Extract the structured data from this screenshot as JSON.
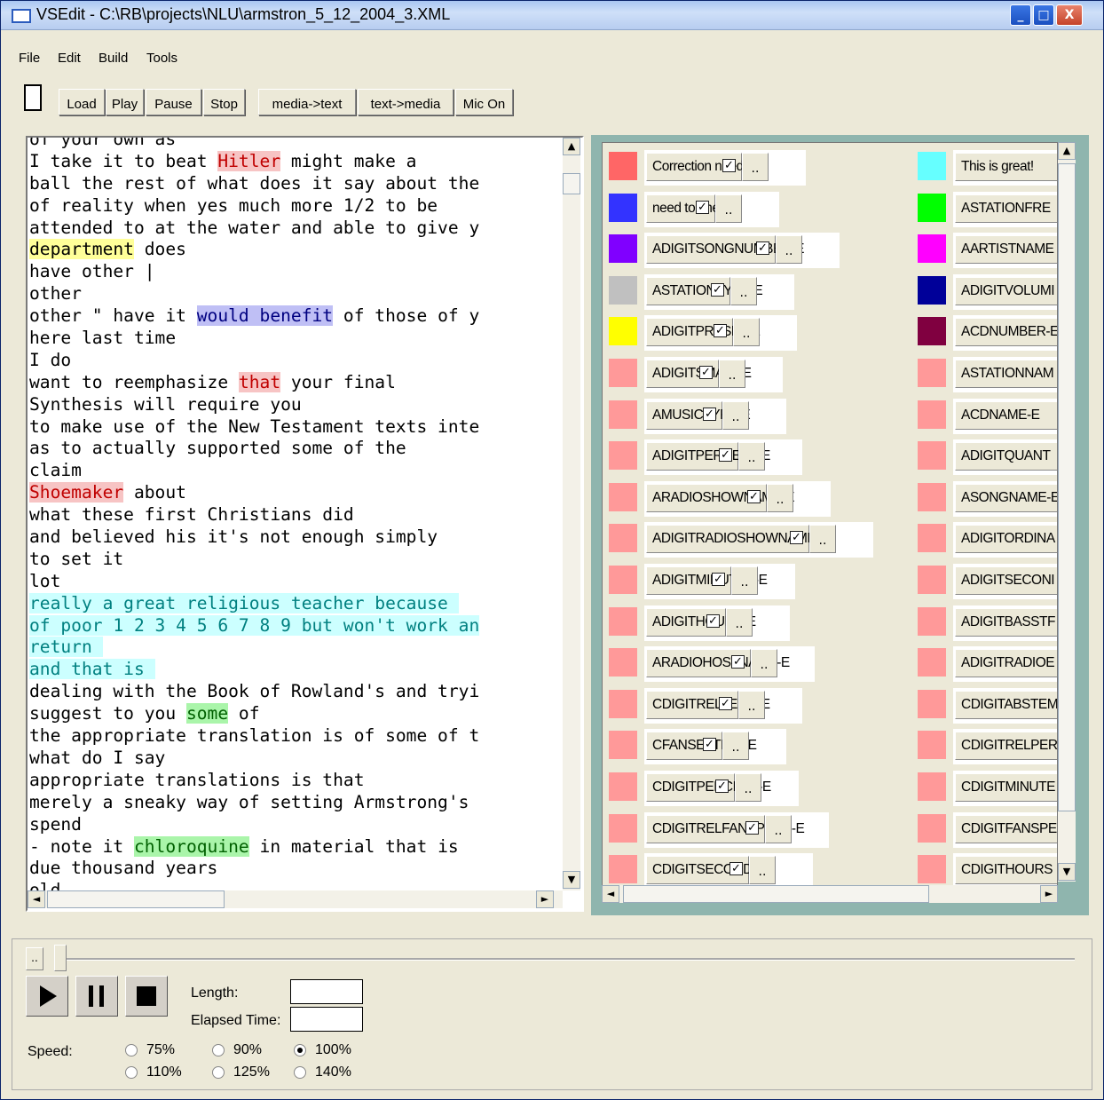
{
  "window": {
    "title": "VSEdit - C:\\RB\\projects\\NLU\\armstron_5_12_2004_3.XML",
    "min": "_",
    "max": "□",
    "close": "X"
  },
  "menu": [
    "File",
    "Edit",
    "Build",
    "Tools"
  ],
  "toolbar": {
    "buttons": [
      "Load",
      "Play",
      "Pause",
      "Stop",
      "media->text",
      "text->media",
      "Mic On"
    ]
  },
  "transcript_lines": [
    [
      {
        "t": "of your own as"
      }
    ],
    [
      {
        "t": "I take it to beat "
      },
      {
        "t": "Hitler",
        "h": "red"
      },
      {
        "t": " might make a"
      }
    ],
    [
      {
        "t": "ball the rest of what does it say about the"
      }
    ],
    [
      {
        "t": "of reality when yes much more 1/2 to be"
      }
    ],
    [
      {
        "t": "attended to at the water and able to give y"
      }
    ],
    [
      {
        "t": "department",
        "h": "yellow"
      },
      {
        "t": " does"
      }
    ],
    [
      {
        "t": "have other |"
      }
    ],
    [
      {
        "t": "other"
      }
    ],
    [
      {
        "t": "other \" have it "
      },
      {
        "t": "would benefit",
        "h": "blue"
      },
      {
        "t": " of those of y"
      }
    ],
    [
      {
        "t": "here last time"
      }
    ],
    [
      {
        "t": "I do"
      }
    ],
    [
      {
        "t": "want to reemphasize "
      },
      {
        "t": "that",
        "h": "red"
      },
      {
        "t": " your final"
      }
    ],
    [
      {
        "t": "Synthesis will require you"
      }
    ],
    [
      {
        "t": "to make use of the New Testament texts inte"
      }
    ],
    [
      {
        "t": "as to actually supported some of the"
      }
    ],
    [
      {
        "t": "claim"
      }
    ],
    [
      {
        "t": "Shoemaker",
        "h": "red"
      },
      {
        "t": " about"
      }
    ],
    [
      {
        "t": "what these first Christians did"
      }
    ],
    [
      {
        "t": "and believed his it's not enough simply"
      }
    ],
    [
      {
        "t": "to set it"
      }
    ],
    [
      {
        "t": "lot"
      }
    ],
    [
      {
        "t": "really a great religious teacher because ",
        "h": "cyan"
      }
    ],
    [
      {
        "t": "of poor 1 2 3 4 5 6 7 8 9 but won't work an",
        "h": "cyan"
      }
    ],
    [
      {
        "t": "return ",
        "h": "cyan"
      }
    ],
    [
      {
        "t": "and that is ",
        "h": "cyan"
      }
    ],
    [
      {
        "t": "dealing with the Book of Rowland's and tryi"
      }
    ],
    [
      {
        "t": "suggest to you "
      },
      {
        "t": "some",
        "h": "green"
      },
      {
        "t": " of"
      }
    ],
    [
      {
        "t": "the appropriate translation is of some of t"
      }
    ],
    [
      {
        "t": "what do I say"
      }
    ],
    [
      {
        "t": "appropriate translations is that"
      }
    ],
    [
      {
        "t": "merely a sneaky way of setting Armstrong's"
      }
    ],
    [
      {
        "t": "spend"
      }
    ],
    [
      {
        "t": "- note it "
      },
      {
        "t": "chloroquine",
        "h": "green"
      },
      {
        "t": " in material that is"
      }
    ],
    [
      {
        "t": "due thousand years"
      }
    ],
    [
      {
        "t": "old"
      }
    ]
  ],
  "tags_left": [
    {
      "name": "Correction needed",
      "color": "#ff6666"
    },
    {
      "name": "need to check",
      "color": "#3333ff"
    },
    {
      "name": "ADIGITSONGNUMBER-E",
      "color": "#8000ff"
    },
    {
      "name": "ASTATIONTYPE-E",
      "color": "#c0c0c0"
    },
    {
      "name": "ADIGITPRESET-E",
      "color": "#ffff00"
    },
    {
      "name": "ADIGITSMALL-E",
      "color": "#ff9999"
    },
    {
      "name": "AMUSICTYPE-E",
      "color": "#ff9999"
    },
    {
      "name": "ADIGITPERCENT-E",
      "color": "#ff9999"
    },
    {
      "name": "ARADIOSHOWNAME-E",
      "color": "#ff9999"
    },
    {
      "name": "ADIGITRADIOSHOWNAME-E",
      "color": "#ff9999"
    },
    {
      "name": "ADIGITMINUTES-E",
      "color": "#ff9999"
    },
    {
      "name": "ADIGITHOURS-E",
      "color": "#ff9999"
    },
    {
      "name": "ARADIOHOSTNAME-E",
      "color": "#ff9999"
    },
    {
      "name": "CDIGITRELTEMP-E",
      "color": "#ff9999"
    },
    {
      "name": "CFANSETTING-E",
      "color": "#ff9999"
    },
    {
      "name": "CDIGITPERCENT-E",
      "color": "#ff9999"
    },
    {
      "name": "CDIGITRELFANSPEED-E",
      "color": "#ff9999"
    },
    {
      "name": "CDIGITSECONDS-E",
      "color": "#ff9999"
    }
  ],
  "tags_right": [
    {
      "name": "This is great!",
      "color": "#66ffff"
    },
    {
      "name": "ASTATIONFRE",
      "color": "#00ff00"
    },
    {
      "name": "AARTISTNAME",
      "color": "#ff00ff"
    },
    {
      "name": "ADIGITVOLUMI",
      "color": "#000099"
    },
    {
      "name": "ACDNUMBER-E",
      "color": "#800040"
    },
    {
      "name": "ASTATIONNAM",
      "color": "#ff9999"
    },
    {
      "name": "ACDNAME-E",
      "color": "#ff9999"
    },
    {
      "name": "ADIGITQUANT",
      "color": "#ff9999"
    },
    {
      "name": "ASONGNAME-E",
      "color": "#ff9999"
    },
    {
      "name": "ADIGITORDINA",
      "color": "#ff9999"
    },
    {
      "name": "ADIGITSECONI",
      "color": "#ff9999"
    },
    {
      "name": "ADIGITBASSTF",
      "color": "#ff9999"
    },
    {
      "name": "ADIGITRADIOE",
      "color": "#ff9999"
    },
    {
      "name": "CDIGITABSTEM",
      "color": "#ff9999"
    },
    {
      "name": "CDIGITRELPER",
      "color": "#ff9999"
    },
    {
      "name": "CDIGITMINUTE",
      "color": "#ff9999"
    },
    {
      "name": "CDIGITFANSPE",
      "color": "#ff9999"
    },
    {
      "name": "CDIGITHOURS",
      "color": "#ff9999"
    }
  ],
  "dropdown_label": "..",
  "player": {
    "length_label": "Length:",
    "elapsed_label": "Elapsed Time:",
    "length_value": "",
    "elapsed_value": "",
    "speed_label": "Speed:",
    "speeds": [
      "75%",
      "90%",
      "100%",
      "110%",
      "125%",
      "140%"
    ],
    "selected_speed": "100%",
    "slider_button": ".."
  }
}
